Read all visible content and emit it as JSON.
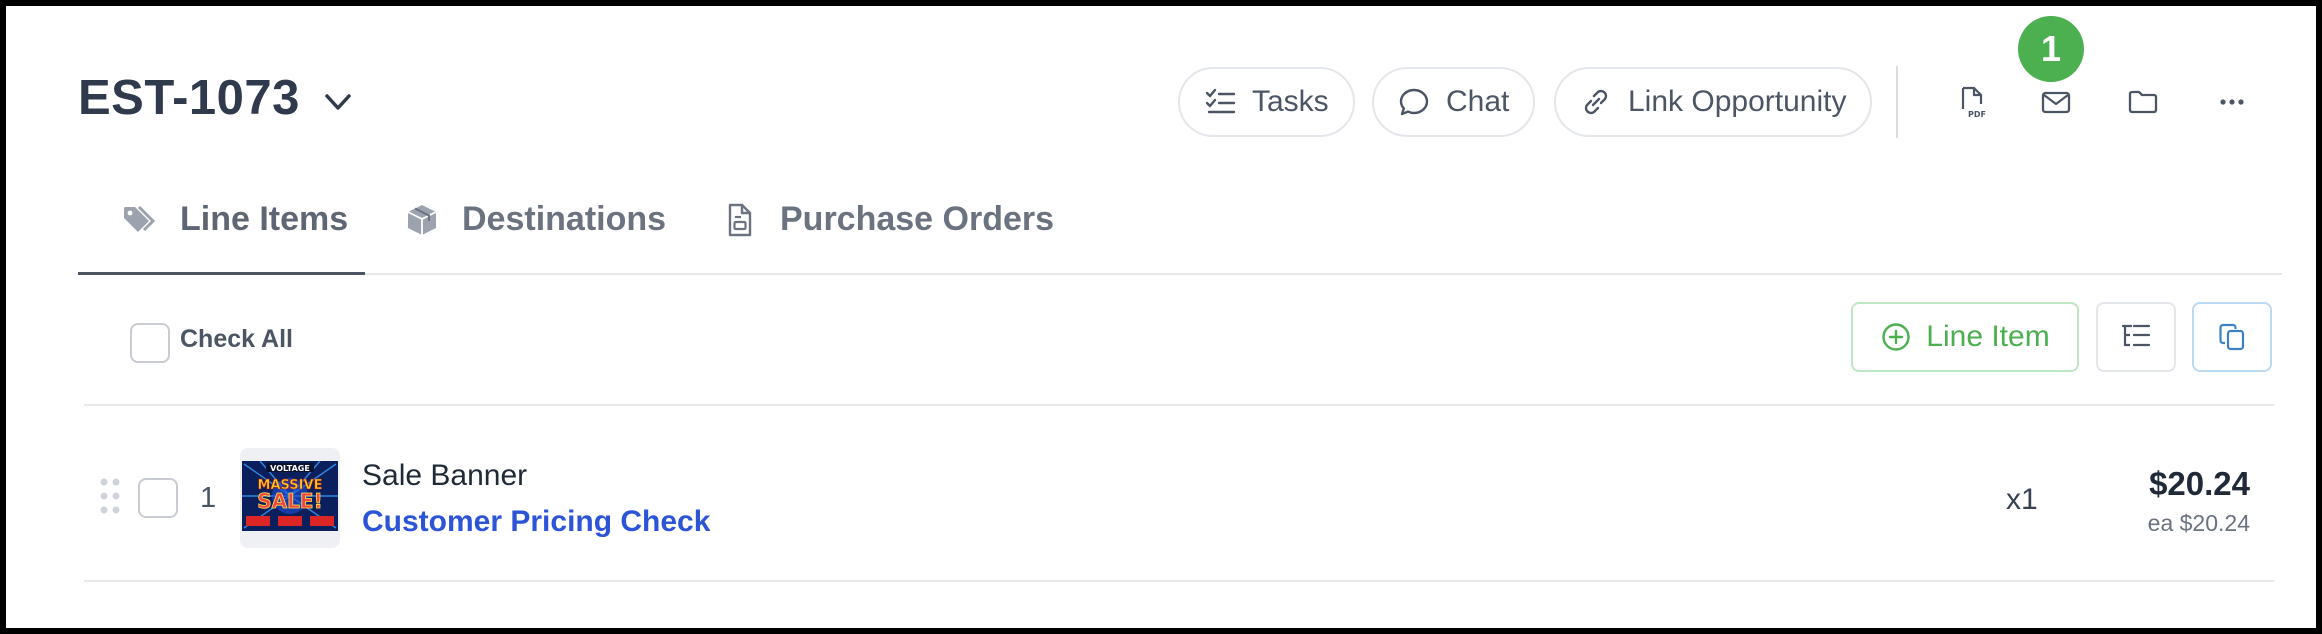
{
  "header": {
    "estimate_id": "EST-1073",
    "actions": {
      "tasks": "Tasks",
      "chat": "Chat",
      "link": "Link Opportunity"
    },
    "notification_count": "1"
  },
  "tabs": [
    {
      "label": "Line Items",
      "active": true
    },
    {
      "label": "Destinations",
      "active": false
    },
    {
      "label": "Purchase Orders",
      "active": false
    }
  ],
  "toolbar": {
    "check_all": "Check All",
    "add_line_item": "Line Item"
  },
  "line_items": [
    {
      "index": "1",
      "name": "Sale Banner",
      "link": "Customer Pricing Check",
      "quantity": "x1",
      "total": "$20.24",
      "each": "ea $20.24",
      "thumbnail_text": {
        "top": "VOLTAGE",
        "main1": "MASSIVE",
        "main2": "SALE!"
      }
    }
  ],
  "colors": {
    "accent_green": "#4caf50",
    "link_blue": "#2c54d6",
    "text_dark": "#2f3a4c"
  }
}
